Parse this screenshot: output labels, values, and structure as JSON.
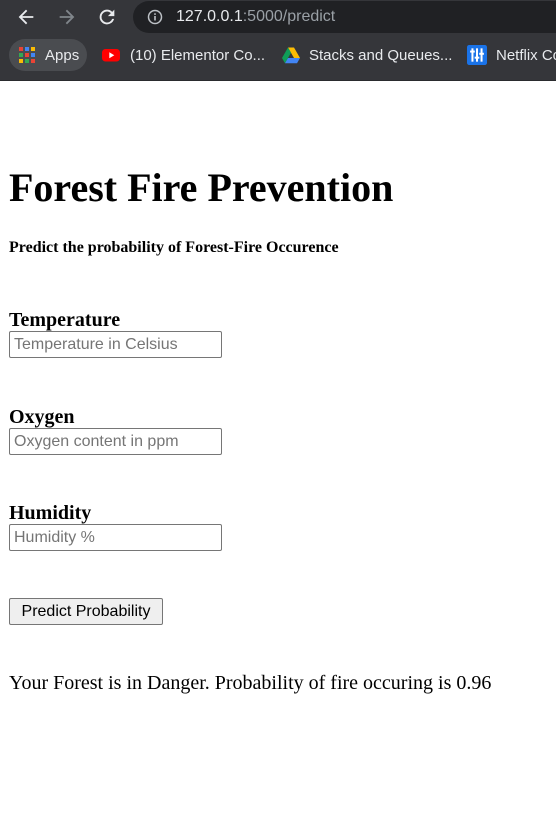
{
  "browser": {
    "url_host": "127.0.0.1",
    "url_rest": ":5000/predict",
    "bookmarks": [
      {
        "label": "Apps",
        "icon": "apps-grid-icon"
      },
      {
        "label": "(10) Elementor Co...",
        "icon": "youtube-icon"
      },
      {
        "label": "Stacks and Queues...",
        "icon": "google-drive-icon"
      },
      {
        "label": "Netflix Co",
        "icon": "netflix-app-icon"
      }
    ]
  },
  "page": {
    "title": "Forest Fire Prevention",
    "subtitle": "Predict the probability of Forest-Fire Occurence",
    "fields": [
      {
        "label": "Temperature",
        "placeholder": "Temperature in Celsius"
      },
      {
        "label": "Oxygen",
        "placeholder": "Oxygen content in ppm"
      },
      {
        "label": "Humidity",
        "placeholder": "Humidity %"
      }
    ],
    "button_label": "Predict Probability",
    "result_text": "Your Forest is in Danger. Probability of fire occuring is 0.96"
  },
  "colors": {
    "chrome_bg": "#35363a",
    "omnibox_bg": "#202124",
    "youtube_red": "#ff0000",
    "netflix_app_blue": "#1a73e8"
  }
}
